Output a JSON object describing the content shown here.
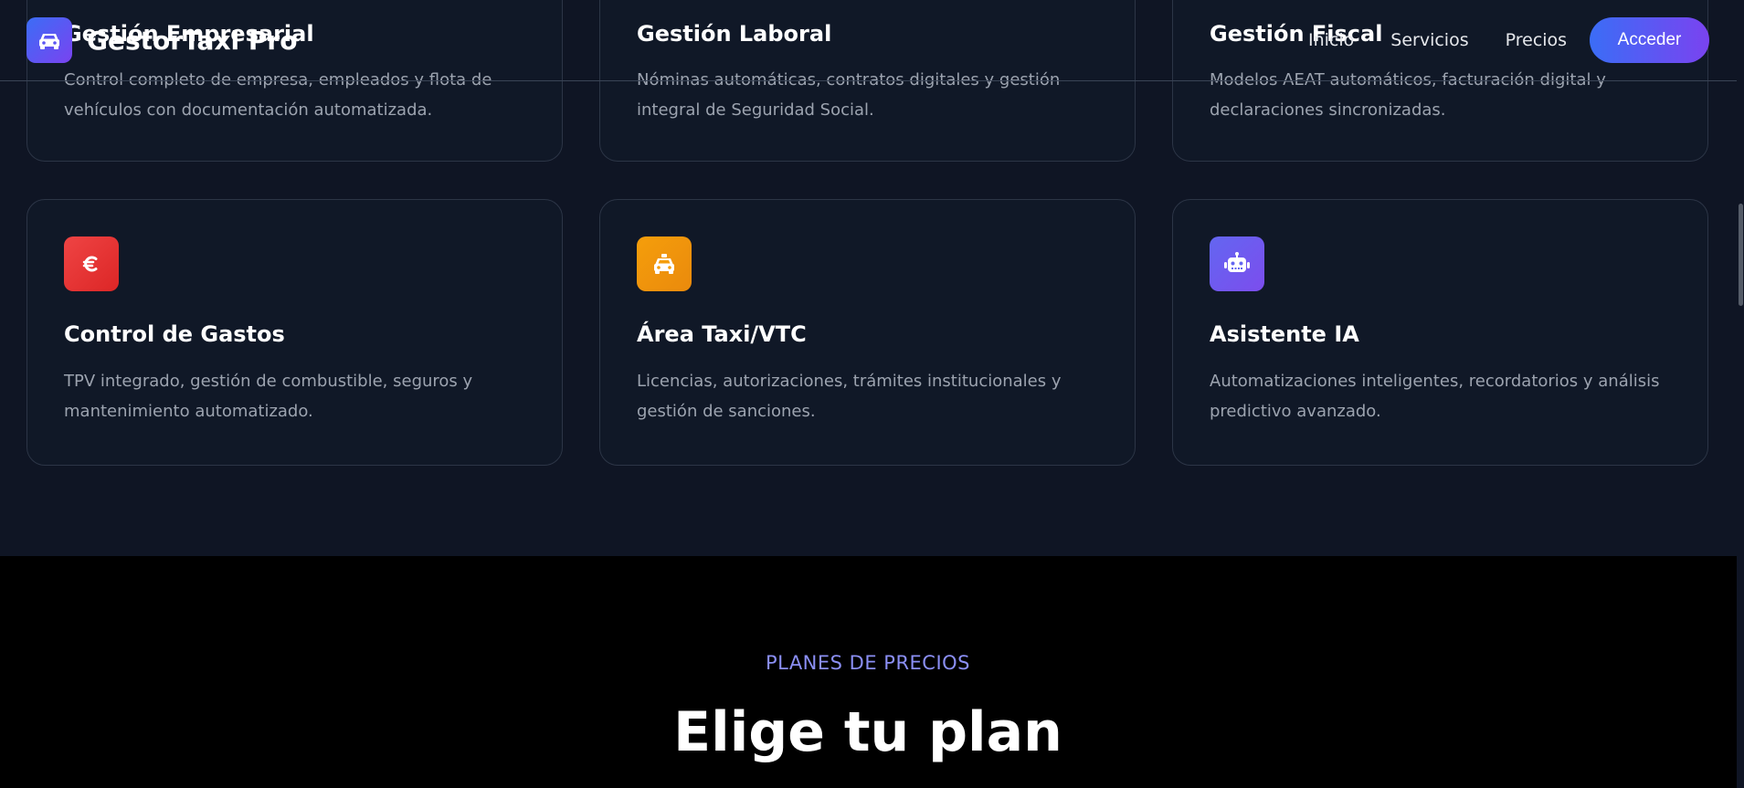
{
  "navbar": {
    "brand": "GestorTaxi Pro",
    "links": [
      "Inicio",
      "Servicios",
      "Precios"
    ],
    "login_label": "Acceder"
  },
  "services": {
    "cards": [
      {
        "title": "Gestión Empresarial",
        "description": "Control completo de empresa, empleados y flota de vehículos con documentación automatizada."
      },
      {
        "title": "Gestión Laboral",
        "description": "Nóminas automáticas, contratos digitales y gestión integral de Seguridad Social."
      },
      {
        "title": "Gestión Fiscal",
        "description": "Modelos AEAT automáticos, facturación digital y declaraciones sincronizadas."
      },
      {
        "title": "Control de Gastos",
        "description": "TPV integrado, gestión de combustible, seguros y mantenimiento automatizado.",
        "icon": "euro-icon",
        "icon_color": "#e53935"
      },
      {
        "title": "Área Taxi/VTC",
        "description": "Licencias, autorizaciones, trámites institucionales y gestión de sanciones.",
        "icon": "taxi-icon",
        "icon_color": "#f59e0b"
      },
      {
        "title": "Asistente IA",
        "description": "Automatizaciones inteligentes, recordatorios y análisis predictivo avanzado.",
        "icon": "robot-icon",
        "icon_color": "#6366f1"
      }
    ]
  },
  "pricing": {
    "eyebrow": "PLANES DE PRECIOS",
    "title": "Elige tu plan"
  }
}
